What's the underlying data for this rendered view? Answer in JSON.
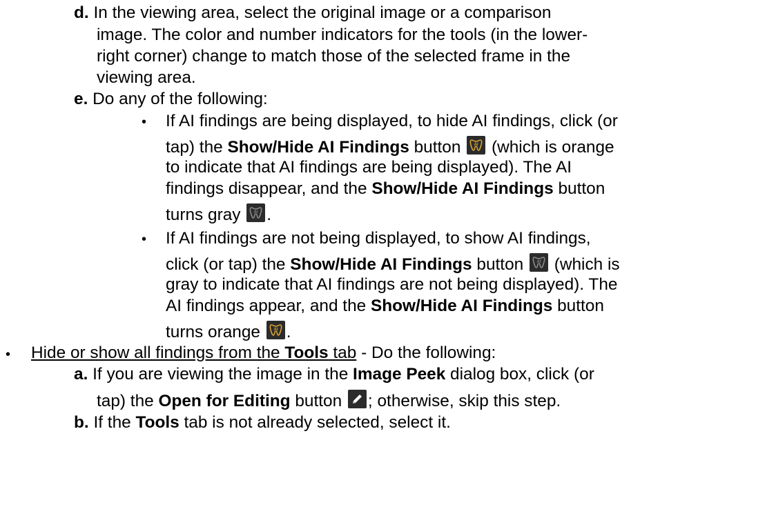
{
  "steps_d_e": {
    "d": {
      "marker": "d.",
      "lines": [
        "In the viewing area, select the original image or a comparison",
        "image. The color and number indicators for the tools (in the lower-",
        "right corner) change to match those of the selected frame in the",
        "viewing area."
      ]
    },
    "e": {
      "marker": "e.",
      "text": "Do any of the following:"
    }
  },
  "hide_bullet": {
    "l1": "If AI findings are being displayed, to hide AI findings, click (or",
    "l2_a": "tap) the ",
    "l2_b": "Show/Hide AI Findings",
    "l2_c": " button ",
    "l2_d": " (which is orange",
    "l3": "to indicate that AI findings are being displayed). The AI",
    "l4_a": "findings disappear, and the ",
    "l4_b": "Show/Hide AI Findings",
    "l4_c": " button",
    "l5_a": "turns gray ",
    "l5_b": "."
  },
  "show_bullet": {
    "l1": "If AI findings are not being displayed, to show AI findings,",
    "l2_a": "click (or tap) the ",
    "l2_b": "Show/Hide AI Findings",
    "l2_c": " button ",
    "l2_d": " (which is",
    "l3": "gray to indicate that AI findings are not being displayed). The",
    "l4_a": "AI findings appear, and the ",
    "l4_b": "Show/Hide AI Findings",
    "l4_c": " button",
    "l5_a": "turns orange ",
    "l5_b": "."
  },
  "tools_section": {
    "link_a": "Hide or show all findings from the ",
    "link_b": "Tools",
    "link_c": " tab",
    "rest": " - Do the following:",
    "a": {
      "marker": "a.",
      "l1_a": "If you are viewing the image in the ",
      "l1_b": "Image Peek",
      "l1_c": " dialog box, click (or",
      "l2_a": "tap) the ",
      "l2_b": "Open for Editing",
      "l2_c": " button ",
      "l2_d": "; otherwise, skip this step."
    },
    "b": {
      "marker": "b.",
      "t_a": "If the ",
      "t_b": "Tools",
      "t_c": " tab is not already selected, select it."
    }
  },
  "icons": {
    "ai_orange": {
      "name": "ai-findings-orange-icon",
      "bg": "#2b2b2b",
      "stroke": "#d9a233"
    },
    "ai_gray": {
      "name": "ai-findings-gray-icon",
      "bg": "#2b2b2b",
      "stroke": "#8a8a8a"
    },
    "edit": {
      "name": "pencil-icon",
      "bg": "#2b2b2b",
      "stroke": "#ffffff"
    }
  }
}
